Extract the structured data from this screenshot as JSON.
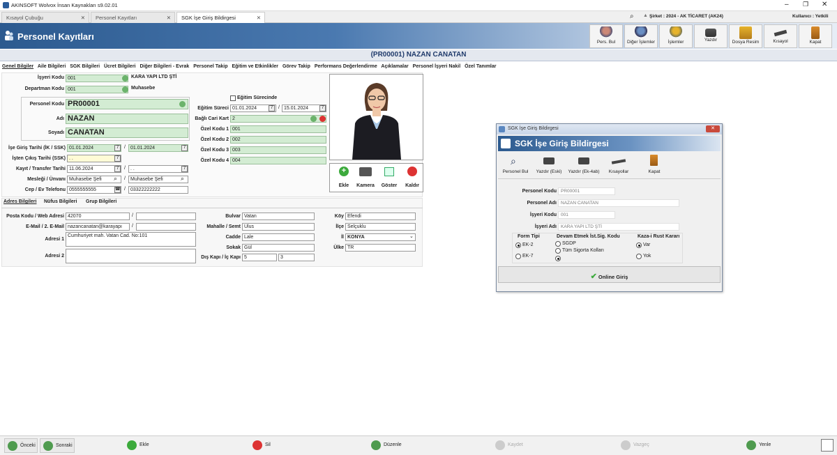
{
  "app": {
    "title": "AKINSOFT Wolvox İnsan Kaynakları s9.02.01",
    "company": "Şirket : 2024 - AK TİCARET (AK24)",
    "user": "Kullanıcı : Yetkili"
  },
  "tabs": [
    {
      "label": "Kısayol Çubuğu"
    },
    {
      "label": "Personel Kayıtları"
    },
    {
      "label": "SGK İşe Giriş Bildirgesi"
    }
  ],
  "banner": {
    "title": "Personel Kayıtları",
    "buttons": [
      "Pers. Bul",
      "Diğer İşlemler",
      "İşlemler",
      "Yazdır",
      "Dosya Resim",
      "Kısayol",
      "Kapat"
    ]
  },
  "header_name": "(PR00001) NAZAN  CANATAN",
  "page_tabs": [
    "Genel Bilgiler",
    "Aile Bilgileri",
    "SGK Bilgileri",
    "Ücret Bilgileri",
    "Diğer Bilgileri - Evrak",
    "Personel Takip",
    "Eğitim ve Etkinlikler",
    "Görev Takip",
    "Performans Değerlendirme",
    "Açıklamalar",
    "Personel İşyeri Nakil",
    "Özel Tanımlar"
  ],
  "form": {
    "isyeri_kodu_label": "İşyeri Kodu",
    "isyeri_kodu": "001",
    "isyeri_adi": "KARA YAPI LTD ŞTİ",
    "departman_label": "Departman Kodu",
    "departman_kodu": "001",
    "departman_adi": "Muhasebe",
    "egitim_surecinde": "Eğitim Sürecinde",
    "personel_kodu_label": "Personel Kodu",
    "personel_kodu": "PR00001",
    "adi_label": "Adı",
    "adi": "NAZAN",
    "soyadi_label": "Soyadı",
    "soyadi": "CANATAN",
    "egitim_sureci_label": "Eğitim Süreci",
    "egitim_bas": "01.01.2024",
    "egitim_bit": "15.01.2024",
    "bagli_cari_label": "Bağlı Cari Kart",
    "bagli_cari": "2",
    "ozel_kod_1_label": "Özel Kodu 1",
    "ozel_kod_1": "001",
    "ozel_kod_2_label": "Özel Kodu 2",
    "ozel_kod_2": "002",
    "ozel_kod_3_label": "Özel Kodu 3",
    "ozel_kod_3": "003",
    "ozel_kod_4_label": "Özel Kodu 4",
    "ozel_kod_4": "004",
    "ise_giris_label": "İşe Giriş Tarihi (İK / SSK)",
    "ise_giris_ik": "01.01.2024",
    "ise_giris_ssk": "01.01.2024",
    "isten_cikis_label": "İşten Çıkış Tarihi (SSK)",
    "isten_cikis": ". .",
    "kayit_transfer_label": "Kayıt / Transfer Tarihi",
    "kayit_tarihi": "11.06.2024",
    "transfer_tarihi": ". .",
    "meslegi_label": "Mesleği / Ünvanı",
    "meslegi": "Muhasebe Şefi",
    "unvani": "Muhasebe Şefi",
    "telefon_label": "Cep / Ev Telefonu",
    "cep_tel": "0555555555",
    "ev_tel": "03322222222",
    "photo_buttons": [
      "Ekle",
      "Kamera",
      "Göster",
      "Kaldır"
    ]
  },
  "sub_tabs": [
    "Adres Bilgileri",
    "Nüfus Bilgileri",
    "Grup Bilgileri"
  ],
  "address": {
    "posta_label": "Posta Kodu / Web Adresi",
    "posta_kodu": "42070",
    "web": "",
    "email_label": "E-Mail / 2. E-Mail",
    "email": "nazancanatan@karayapı",
    "email2": "",
    "adres1_label": "Adresi 1",
    "adres1": "Cumhuriyet mah. Vatan Cad. No:101",
    "adres2_label": "Adresi 2",
    "adres2": "",
    "bulvar_label": "Bulvar",
    "bulvar": "Vatan",
    "mahalle_label": "Mahalle / Semt",
    "mahalle": "Ulus",
    "cadde_label": "Cadde",
    "cadde": "Lale",
    "sokak_label": "Sokak",
    "sokak": "Gül",
    "dis_kapi_label": "Dış Kapı / İç Kapı",
    "dis_kapi": "5",
    "ic_kapi": "3",
    "koy_label": "Köy",
    "koy": "Efendi",
    "ilce_label": "İlçe",
    "ilce": "Selçuklu",
    "il_label": "İl",
    "il": "KONYA",
    "ulke_label": "Ülke",
    "ulke": "TR"
  },
  "dialog": {
    "window_title": "SGK İşe Giriş Bildirgesi",
    "header": "SGK İşe Giriş Bildirgesi",
    "buttons": [
      "Personel Bul",
      "Yazdır (Eski)",
      "Yazdır (Ek-4ab)",
      "Kısayollar",
      "Kapat"
    ],
    "personel_kodu_label": "Personel Kodu",
    "personel_kodu": "PR00001",
    "personel_adi_label": "Personel Adı",
    "personel_adi": "NAZAN  CANATAN",
    "isyeri_kodu_label": "İşyeri Kodu",
    "isyeri_kodu": "001",
    "isyeri_adi_label": "İşyeri Adı",
    "isyeri_adi": "KARA YAPI LTD ŞTİ",
    "form_tipi_label": "Form Tipi",
    "form_tipi_options": [
      "EK-2",
      "EK-7"
    ],
    "devam_label": "Devam Etmek İst.Sig. Kodu",
    "devam_options": [
      "SGDP",
      "Tüm Sigorta Kolları",
      ""
    ],
    "kaza_label": "Kaza-i Rust Kararı",
    "kaza_options": [
      "Var",
      "Yok"
    ],
    "online_giris": "Online Giriş"
  },
  "statusbar": [
    "Önceki",
    "Sonraki",
    "Ekle",
    "Sil",
    "Düzenle",
    "Kaydet",
    "Vazgeç",
    "Yenle"
  ]
}
